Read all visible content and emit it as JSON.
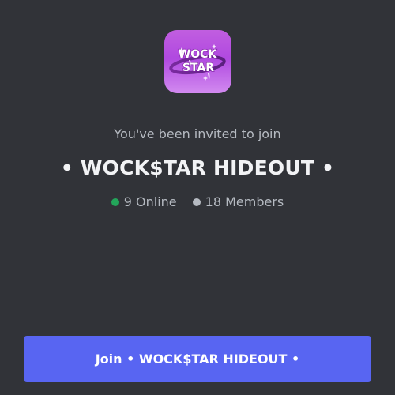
{
  "invite": {
    "subtitle": "You've been invited to join",
    "server_name": "• WOCK$TAR HIDEOUT •",
    "icon": {
      "name": "server-icon",
      "lettering": "WOCK STAR"
    },
    "stats": {
      "online_label": "9 Online",
      "members_label": "18 Members",
      "online_color": "#23a55a",
      "members_color": "#b5bac1"
    },
    "join_button": {
      "label": "Join • WOCK$TAR HIDEOUT •",
      "color": "#5865f2"
    }
  },
  "theme": {
    "background": "#313338",
    "text_primary": "#f2f3f5",
    "text_muted": "#b5bac1"
  }
}
